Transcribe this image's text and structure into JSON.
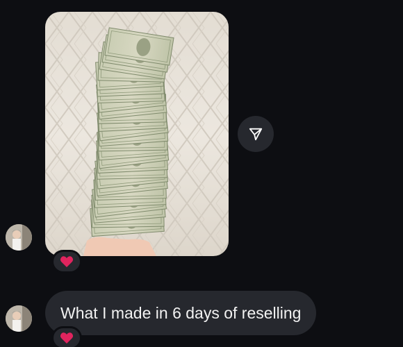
{
  "thread": {
    "background_color": "#0d0e12",
    "bubble_color": "#26282e"
  },
  "messages": [
    {
      "kind": "photo",
      "photo_description_icon": "cash-fan-photo",
      "reaction": "heart-icon",
      "reaction_color": "#e0245e"
    },
    {
      "kind": "text",
      "text": "What I made in 6 days of reselling",
      "reaction": "heart-icon",
      "reaction_color": "#e0245e"
    }
  ],
  "actions": {
    "share_icon": "share-send-icon"
  }
}
